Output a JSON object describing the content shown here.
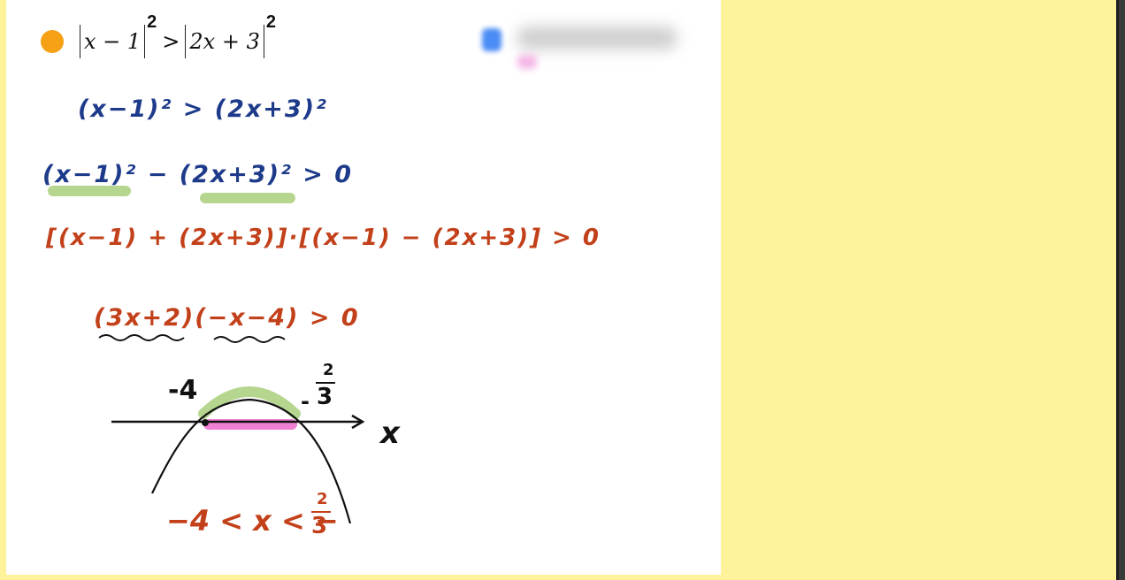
{
  "problem": {
    "lhs": "x − 1",
    "lhs_exp": "2",
    "relation": ">",
    "rhs": "2x + 3",
    "rhs_exp": "2"
  },
  "steps": [
    "(x−1)² > (2x+3)²",
    "(x−1)² − (2x+3)² > 0",
    "[(x−1) + (2x+3)]·[(x−1) − (2x+3)] > 0",
    "(3x+2)(−x−4) > 0"
  ],
  "graph": {
    "root_left": "-4",
    "root_right_num": "2",
    "root_right_den": "3",
    "root_right_sign": "-",
    "axis_label": "x"
  },
  "answer": {
    "left": "−4 < x < −",
    "frac_num": "2",
    "frac_den": "3"
  },
  "colors": {
    "bullet": "#f5a015",
    "blue_ink": "#1d3b8a",
    "red_ink": "#c2411a",
    "green_highlight": "#a9cf7b",
    "pink_highlight": "#ea60c8",
    "background": "#fef39a"
  }
}
